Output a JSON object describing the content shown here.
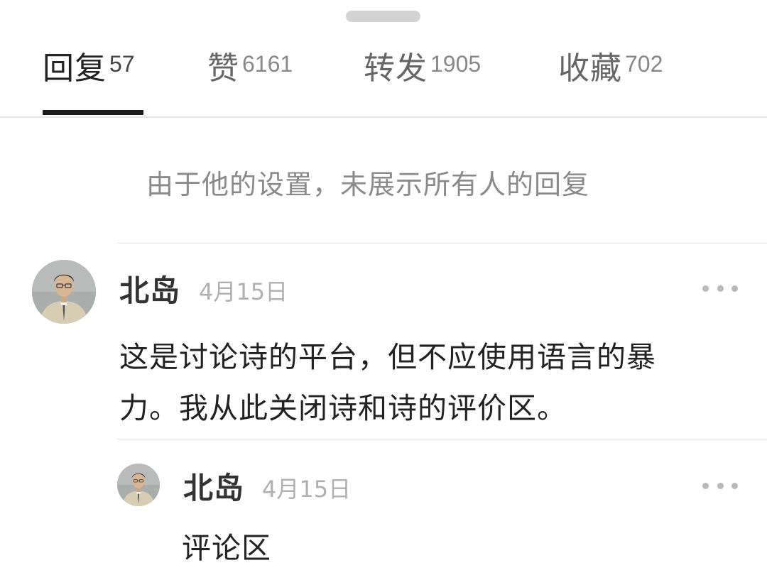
{
  "tabs": [
    {
      "label": "回复",
      "count": "57",
      "active": true
    },
    {
      "label": "赞",
      "count": "6161",
      "active": false
    },
    {
      "label": "转发",
      "count": "1905",
      "active": false
    },
    {
      "label": "收藏",
      "count": "702",
      "active": false
    }
  ],
  "notice": "由于他的设置，未展示所有人的回复",
  "comments": [
    {
      "username": "北岛",
      "date": "4月15日",
      "text_lines": [
        "这是讨论诗的平台，但不应使用语言的暴",
        "力。我从此关闭诗和诗的评价区。"
      ]
    },
    {
      "username": "北岛",
      "date": "4月15日",
      "text_lines": [
        "评论区"
      ]
    }
  ],
  "icons": {
    "more": "more-horizontal-icon",
    "avatar": "user-avatar"
  }
}
